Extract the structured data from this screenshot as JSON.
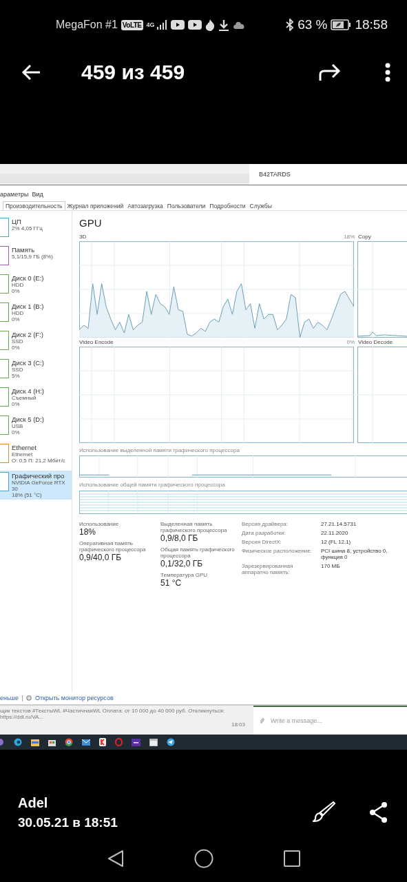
{
  "status_bar": {
    "carrier": "MegaFon #1",
    "volte": "VoLTE",
    "network": "4G",
    "battery_percent": "63 %",
    "time": "18:58"
  },
  "app_bar": {
    "title": "459 из 459"
  },
  "screenshot": {
    "chat_header": "B42TARDS",
    "menu": [
      "араметры",
      "Вид"
    ],
    "tabs": [
      {
        "label": "Производительность",
        "selected": true
      },
      {
        "label": "Журнал приложений",
        "selected": false
      },
      {
        "label": "Автозагрузка",
        "selected": false
      },
      {
        "label": "Пользователи",
        "selected": false
      },
      {
        "label": "Подробности",
        "selected": false
      },
      {
        "label": "Службы",
        "selected": false
      }
    ],
    "sidebar": [
      {
        "name": "ЦП",
        "lines": [
          "2% 4,05 ГГц"
        ],
        "color": "#4a9fd8",
        "selected": false
      },
      {
        "name": "Память",
        "lines": [
          "5,1/15,9 ГБ (8%)"
        ],
        "color": "#a05ab8",
        "selected": false
      },
      {
        "name": "Диск 0 (E:)",
        "lines": [
          "HDD",
          "0%"
        ],
        "color": "#6aa84f",
        "selected": false
      },
      {
        "name": "Диск 1 (B:)",
        "lines": [
          "HDD",
          "0%"
        ],
        "color": "#6aa84f",
        "selected": false
      },
      {
        "name": "Диск 2 (F:)",
        "lines": [
          "SSD",
          "0%"
        ],
        "color": "#6aa84f",
        "selected": false
      },
      {
        "name": "Диск 3 (C:)",
        "lines": [
          "SSD",
          "5%"
        ],
        "color": "#6aa84f",
        "selected": false
      },
      {
        "name": "Диск 4 (H:)",
        "lines": [
          "Съемный",
          "0%"
        ],
        "color": "#6aa84f",
        "selected": false
      },
      {
        "name": "Диск 5 (D:)",
        "lines": [
          "USB",
          "0%"
        ],
        "color": "#6aa84f",
        "selected": false
      },
      {
        "name": "Ethernet",
        "lines": [
          "Ethernet",
          "О: 0,5 П: 21,2 Мбит/с"
        ],
        "color": "#d98a2b",
        "selected": false
      },
      {
        "name": "Графический про",
        "lines": [
          "NVIDIA GeForce RTX 30",
          "18% (51 °C)"
        ],
        "color": "#4a9fd8",
        "selected": true
      }
    ],
    "title": "GPU",
    "charts": [
      {
        "label": "3D",
        "reading": "18%",
        "side": "Copy"
      },
      {
        "label": "Video Encode",
        "reading": "0%",
        "side": "Video Decode"
      }
    ],
    "memory_graphs": [
      "Использование выделенной памяти графического процессора",
      "Использование общей памяти графического процессора"
    ],
    "stats": [
      {
        "label": "Использование",
        "value": "18%"
      },
      {
        "label": "Выделенная память графического процессора",
        "value": "0,9/8,0 ГБ"
      },
      {
        "label": "Оперативная память графического процессора",
        "value": "0,9/40,0 ГБ"
      },
      {
        "label": "Общая память графического процессора",
        "value": "0,1/32,0 ГБ"
      },
      {
        "label": "Температура GPU",
        "value": "51 °C"
      }
    ],
    "info": [
      {
        "label": "Версия драйвера:",
        "value": "27.21.14.5731"
      },
      {
        "label": "Дата разработки:",
        "value": "22.11.2020"
      },
      {
        "label": "Версия DirectX:",
        "value": "12 (FL 12.1)"
      },
      {
        "label": "Физическое расположение:",
        "value": "PCI шина 8, устройство 0, функция 0"
      },
      {
        "label": "Зарезервированная аппаратно память:",
        "value": "170 МБ"
      }
    ],
    "fewer_link": "еньше",
    "resource_monitor_link": "Открыть монитор ресурсов",
    "chat_preview": "щик текстов #ТекстыWL #ЧастичнаяWL  Оплата: от 10 000 до 40 000 руб.  Откликнуться: https://ddl.ru/VA...",
    "chat_time": "18:03",
    "message_placeholder": "Write a message..."
  },
  "footer": {
    "author": "Adel",
    "date": "30.05.21 в 18:51"
  }
}
